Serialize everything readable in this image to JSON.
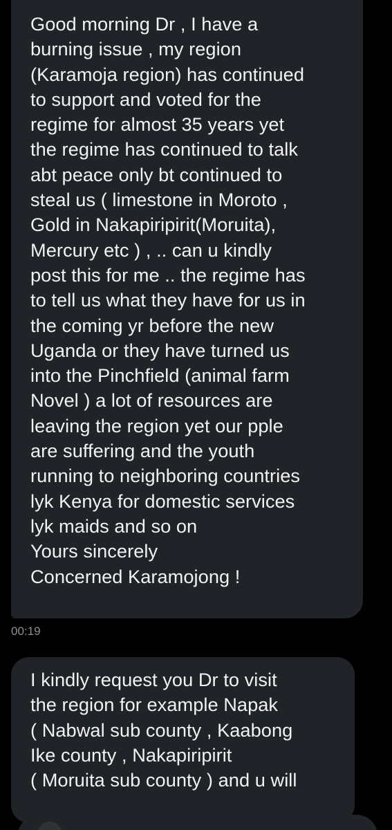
{
  "thread": {
    "messages": [
      {
        "text": "Good morning Dr , I have a\nburning issue , my region\n(Karamoja region) has continued\nto support and voted for the\nregime for almost 35 years yet\nthe regime has continued to talk\nabt peace only  bt continued to\nsteal us  ( limestone in Moroto ,\nGold in Nakapiripirit(Moruita),\nMercury etc ) , .. can u kindly\npost this for me .. the regime has\nto tell us what they have for us in\nthe coming yr  before the new\nUganda or they have turned us\ninto the Pinchfield (animal farm\nNovel ) a lot of resources are\nleaving the region yet our pple\nare suffering and the youth\nrunning to neighboring countries\nlyk Kenya for domestic services\nlyk maids and so on\nYours sincerely\nConcerned Karamojong !",
        "timestamp": "00:19"
      },
      {
        "text": "I kindly request you Dr to visit\nthe region for example Napak\n( Nabwal sub county  , Kaabong\nIke county , Nakapiripirit\n( Moruita sub county ) and u will"
      }
    ]
  },
  "colors": {
    "background": "#000000",
    "bubble": "#202327",
    "text": "#f2f2f2",
    "timestamp": "#8b9096"
  }
}
